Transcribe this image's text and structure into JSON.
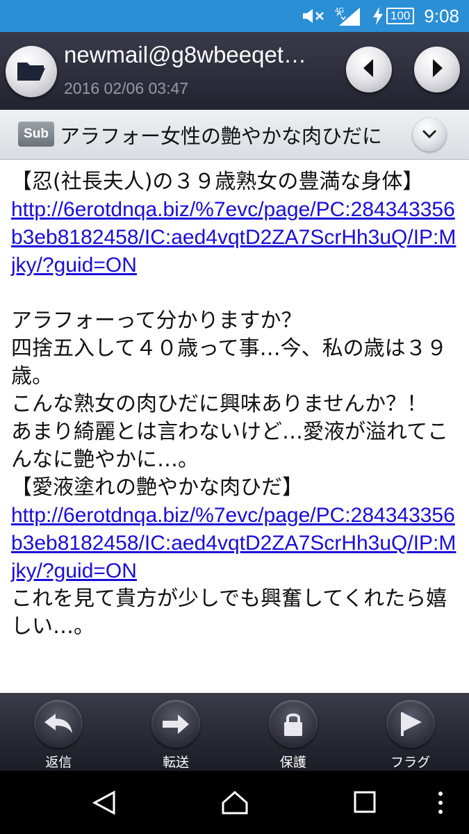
{
  "status_bar": {
    "mute_icon": "speaker-muted-icon",
    "network_type": "4G",
    "signal_icon": "signal-icon",
    "charging_icon": "lightning-icon",
    "battery_level": "100",
    "time": "9:08"
  },
  "header": {
    "folder_icon": "folder-icon",
    "sender": "newmail@g8wbeeqet…",
    "date": "2016 02/06 03:47",
    "prev_icon": "triangle-left-icon",
    "next_icon": "triangle-right-icon"
  },
  "subject": {
    "badge": "Sub",
    "text": "アラフォー女性の艶やかな肉ひだに",
    "expand_icon": "chevron-down-icon"
  },
  "body": {
    "line1": "【忍(社長夫人)の３９歳熟女の豊満な身体】",
    "link1": "http://6erotdnqa.biz/%7evc/page/PC:284343356b3eb8182458/IC:aed4vqtD2ZA7ScrHh3uQ/IP:Mjky/?guid=ON",
    "line2": "アラフォーって分かりますか？",
    "line3": "四捨五入して４０歳って事…今、私の歳は３９歳。",
    "line4": "こんな熟女の肉ひだに興味ありませんか？！",
    "line5": "あまり綺麗とは言わないけど…愛液が溢れてこんなに艶やかに…。",
    "line6": "【愛液塗れの艶やかな肉ひだ】",
    "link2": "http://6erotdnqa.biz/%7evc/page/PC:284343356b3eb8182458/IC:aed4vqtD2ZA7ScrHh3uQ/IP:Mjky/?guid=ON",
    "line7": "これを見て貴方が少しでも興奮してくれたら嬉しい…。"
  },
  "toolbar": {
    "reply_label": "返信",
    "forward_label": "転送",
    "protect_label": "保護",
    "flag_label": "フラグ"
  },
  "colors": {
    "status_bar": "#2b8fd6",
    "link": "#1a0dd8",
    "header_bg": "#2b2b38"
  }
}
